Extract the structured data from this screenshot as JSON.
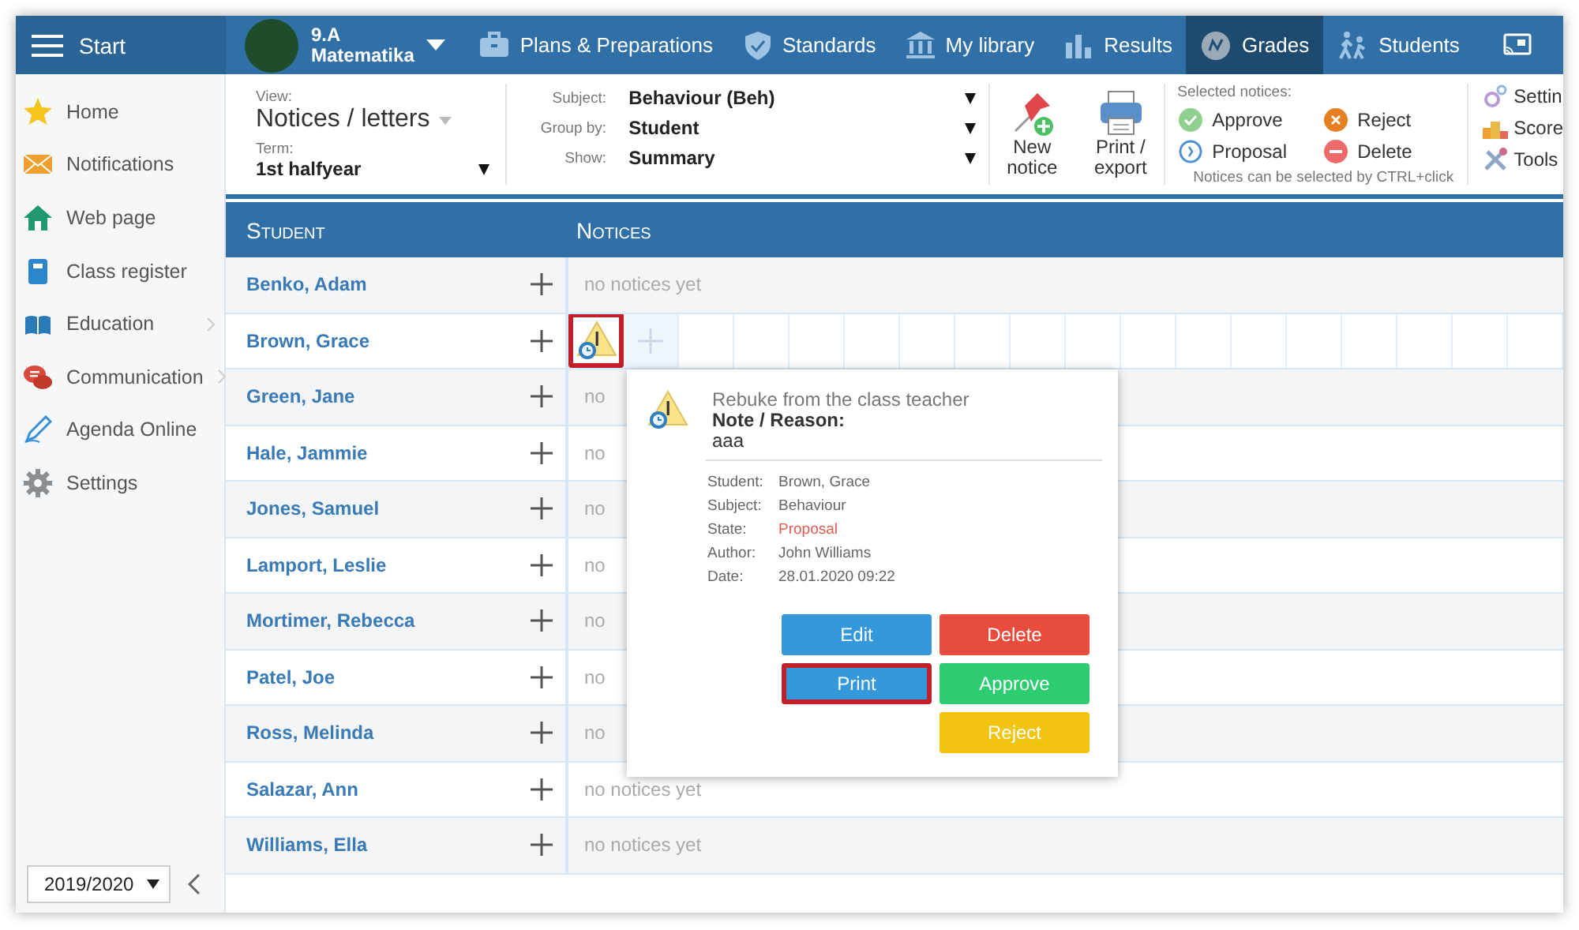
{
  "top_bar": {
    "start_label": "Start",
    "class_name": "9.A",
    "class_subject": "Matematika",
    "nav": [
      {
        "kind": "plans",
        "label": "Plans & Preparations",
        "selected": false
      },
      {
        "kind": "standards",
        "label": "Standards",
        "selected": false
      },
      {
        "kind": "library",
        "label": "My library",
        "selected": false
      },
      {
        "kind": "results",
        "label": "Results",
        "selected": false
      },
      {
        "kind": "grades",
        "label": "Grades",
        "selected": true
      },
      {
        "kind": "students",
        "label": "Students",
        "selected": false
      }
    ]
  },
  "sidebar": {
    "items": [
      {
        "kind": "home",
        "label": "Home",
        "has_submenu": false
      },
      {
        "kind": "notifications",
        "label": "Notifications",
        "has_submenu": false
      },
      {
        "kind": "web",
        "label": "Web page",
        "has_submenu": false
      },
      {
        "kind": "register",
        "label": "Class register",
        "has_submenu": false
      },
      {
        "kind": "education",
        "label": "Education",
        "has_submenu": true
      },
      {
        "kind": "communication",
        "label": "Communication",
        "has_submenu": true
      },
      {
        "kind": "agenda",
        "label": "Agenda Online",
        "has_submenu": false
      },
      {
        "kind": "settings",
        "label": "Settings",
        "has_submenu": false
      }
    ],
    "year_select": "2019/2020"
  },
  "toolbar": {
    "view_label": "View:",
    "view_value": "Notices / letters",
    "term_label": "Term:",
    "term_value": "1st halfyear",
    "filters": [
      {
        "label": "Subject:",
        "value": "Behaviour (Beh)"
      },
      {
        "label": "Group by:",
        "value": "Student"
      },
      {
        "label": "Show:",
        "value": "Summary"
      }
    ],
    "actions": [
      {
        "kind": "new",
        "label": "New notice"
      },
      {
        "kind": "print",
        "label": "Print / export"
      }
    ],
    "selected_title": "Selected notices:",
    "selected_actions": [
      {
        "kind": "approve",
        "label": "Approve"
      },
      {
        "kind": "reject",
        "label": "Reject"
      },
      {
        "kind": "proposal",
        "label": "Proposal"
      },
      {
        "kind": "delete",
        "label": "Delete"
      }
    ],
    "selected_hint": "Notices can be selected by CTRL+click",
    "tools": [
      {
        "kind": "settings",
        "label": "Settin"
      },
      {
        "kind": "score",
        "label": "Score"
      },
      {
        "kind": "tools",
        "label": "Tools"
      }
    ]
  },
  "table": {
    "columns": [
      "Student",
      "Notices"
    ],
    "rows": [
      {
        "student": "Benko, Adam",
        "notices_text": "no notices yet",
        "notices": []
      },
      {
        "student": "Brown, Grace",
        "notices": [
          {
            "highlighted": true
          }
        ]
      },
      {
        "student": "Green, Jane",
        "notices_text": "no",
        "notices": []
      },
      {
        "student": "Hale, Jammie",
        "notices_text": "no",
        "notices": []
      },
      {
        "student": "Jones, Samuel",
        "notices_text": "no",
        "notices": []
      },
      {
        "student": "Lamport, Leslie",
        "notices_text": "no",
        "notices": []
      },
      {
        "student": "Mortimer, Rebecca",
        "notices_text": "no",
        "notices": []
      },
      {
        "student": "Patel, Joe",
        "notices_text": "no",
        "notices": []
      },
      {
        "student": "Ross, Melinda",
        "notices_text": "no",
        "notices": []
      },
      {
        "student": "Salazar, Ann",
        "notices_text": "no notices yet",
        "notices": []
      },
      {
        "student": "Williams, Ella",
        "notices_text": "no notices yet",
        "notices": []
      }
    ]
  },
  "popup": {
    "title": "Rebuke from the class teacher",
    "note_label": "Note / Reason:",
    "note": "aaa",
    "details": [
      {
        "label": "Student:",
        "value": "Brown, Grace"
      },
      {
        "label": "Subject:",
        "value": "Behaviour"
      },
      {
        "label": "State:",
        "value": "Proposal",
        "color": "#e05a4f"
      },
      {
        "label": "Author:",
        "value": "John Williams"
      },
      {
        "label": "Date:",
        "value": "28.01.2020 09:22"
      }
    ],
    "button_columns": [
      [
        {
          "label": "Edit",
          "color": "#3498db",
          "highlighted": false
        },
        {
          "label": "Print",
          "color": "#3498db",
          "highlighted": true
        }
      ],
      [
        {
          "label": "Delete",
          "color": "#e74c3c",
          "highlighted": false
        },
        {
          "label": "Approve",
          "color": "#2ecc71",
          "highlighted": false
        },
        {
          "label": "Reject",
          "color": "#f1c40f",
          "highlighted": false
        }
      ]
    ]
  }
}
